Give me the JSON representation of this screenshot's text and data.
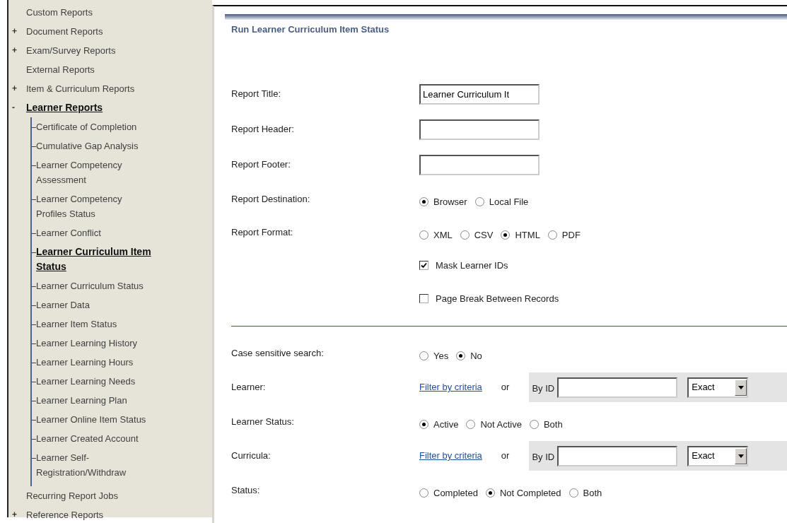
{
  "sidebar": {
    "items": [
      {
        "label": "Custom Reports",
        "selected": false
      },
      {
        "label": "Document Reports",
        "expander": "+",
        "selected": false
      },
      {
        "label": "Exam/Survey Reports",
        "expander": "+",
        "selected": false
      },
      {
        "label": "External Reports",
        "selected": false
      },
      {
        "label": "Item & Curriculum Reports",
        "expander": "+",
        "selected": false
      },
      {
        "label": "Learner Reports",
        "expander": "-",
        "selected": true,
        "children": [
          {
            "label": "Certificate of Completion",
            "selected": false
          },
          {
            "label": "Cumulative Gap Analysis",
            "selected": false
          },
          {
            "label": "Learner Competency Assessment",
            "selected": false
          },
          {
            "label": "Learner Competency Profiles Status",
            "selected": false
          },
          {
            "label": "Learner Conflict",
            "selected": false
          },
          {
            "label": "Learner Curriculum Item Status",
            "selected": true
          },
          {
            "label": "Learner Curriculum Status",
            "selected": false
          },
          {
            "label": "Learner Data",
            "selected": false
          },
          {
            "label": "Learner Item Status",
            "selected": false
          },
          {
            "label": "Learner Learning History",
            "selected": false
          },
          {
            "label": "Learner Learning Hours",
            "selected": false
          },
          {
            "label": "Learner Learning Needs",
            "selected": false
          },
          {
            "label": "Learner Learning Plan",
            "selected": false
          },
          {
            "label": "Learner Online Item Status",
            "selected": false
          },
          {
            "label": "Learner Created Account",
            "selected": false
          },
          {
            "label": "Learner Self-Registration/Withdraw",
            "selected": false
          }
        ]
      },
      {
        "label": "Recurring Report Jobs",
        "selected": false
      },
      {
        "label": "Reference Reports",
        "expander": "+",
        "selected": false
      }
    ]
  },
  "form": {
    "title": "Run Learner Curriculum Item Status",
    "rows": [
      {
        "kind": "text",
        "label": "Report Title:",
        "value": "Learner Curriculum It"
      },
      {
        "kind": "text",
        "label": "Report Header:"
      },
      {
        "kind": "text",
        "label": "Report Footer:"
      },
      {
        "kind": "radio",
        "label": "Report Destination:",
        "options": [
          {
            "label": "Browser",
            "selected": true
          },
          {
            "label": "Local File",
            "selected": false
          }
        ]
      },
      {
        "kind": "radio",
        "label": "Report Format:",
        "options": [
          {
            "label": "XML",
            "selected": false
          },
          {
            "label": "CSV",
            "selected": false
          },
          {
            "label": "HTML",
            "selected": true
          },
          {
            "label": "PDF",
            "selected": false
          }
        ]
      },
      {
        "kind": "checkbox",
        "option": "Mask Learner IDs",
        "checked": true
      },
      {
        "kind": "checkbox",
        "option": "Page Break Between Records",
        "checked": false
      },
      {
        "kind": "separator"
      },
      {
        "kind": "radio",
        "label": "Case sensitive search:",
        "options": [
          {
            "label": "Yes",
            "selected": false
          },
          {
            "label": "No",
            "selected": true
          }
        ]
      },
      {
        "kind": "lookup",
        "label": "Learner:",
        "link": "Filter by criteria",
        "or": "or",
        "id_label": "By ID",
        "match": "Exact"
      },
      {
        "kind": "radio",
        "label": "Learner Status:",
        "options": [
          {
            "label": "Active",
            "selected": true
          },
          {
            "label": "Not Active",
            "selected": false
          },
          {
            "label": "Both",
            "selected": false
          }
        ]
      },
      {
        "kind": "lookup",
        "label": "Curricula:",
        "link": "Filter by criteria",
        "or": "or",
        "id_label": "By ID",
        "match": "Exact"
      },
      {
        "kind": "radio",
        "label": "Status:",
        "options": [
          {
            "label": "Completed",
            "selected": false
          },
          {
            "label": "Not Completed",
            "selected": true
          },
          {
            "label": "Both",
            "selected": false
          }
        ]
      }
    ]
  }
}
